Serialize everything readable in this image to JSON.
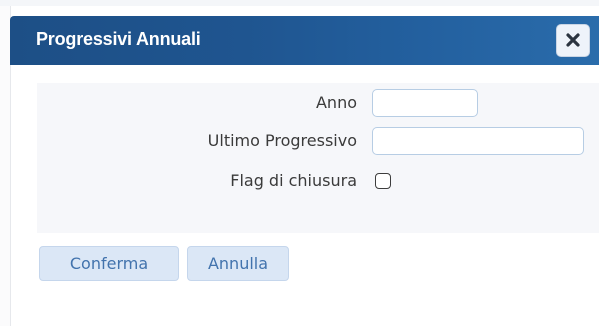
{
  "dialog": {
    "title": "Progressivi Annuali",
    "close_icon": "close-icon",
    "accent_color": "#1f5590"
  },
  "form": {
    "fields": [
      {
        "label": "Anno",
        "value": ""
      },
      {
        "label": "Ultimo Progressivo",
        "value": ""
      }
    ],
    "checkbox": {
      "label": "Flag di chiusura",
      "checked": false
    }
  },
  "actions": {
    "confirm_label": "Conferma",
    "cancel_label": "Annulla"
  }
}
